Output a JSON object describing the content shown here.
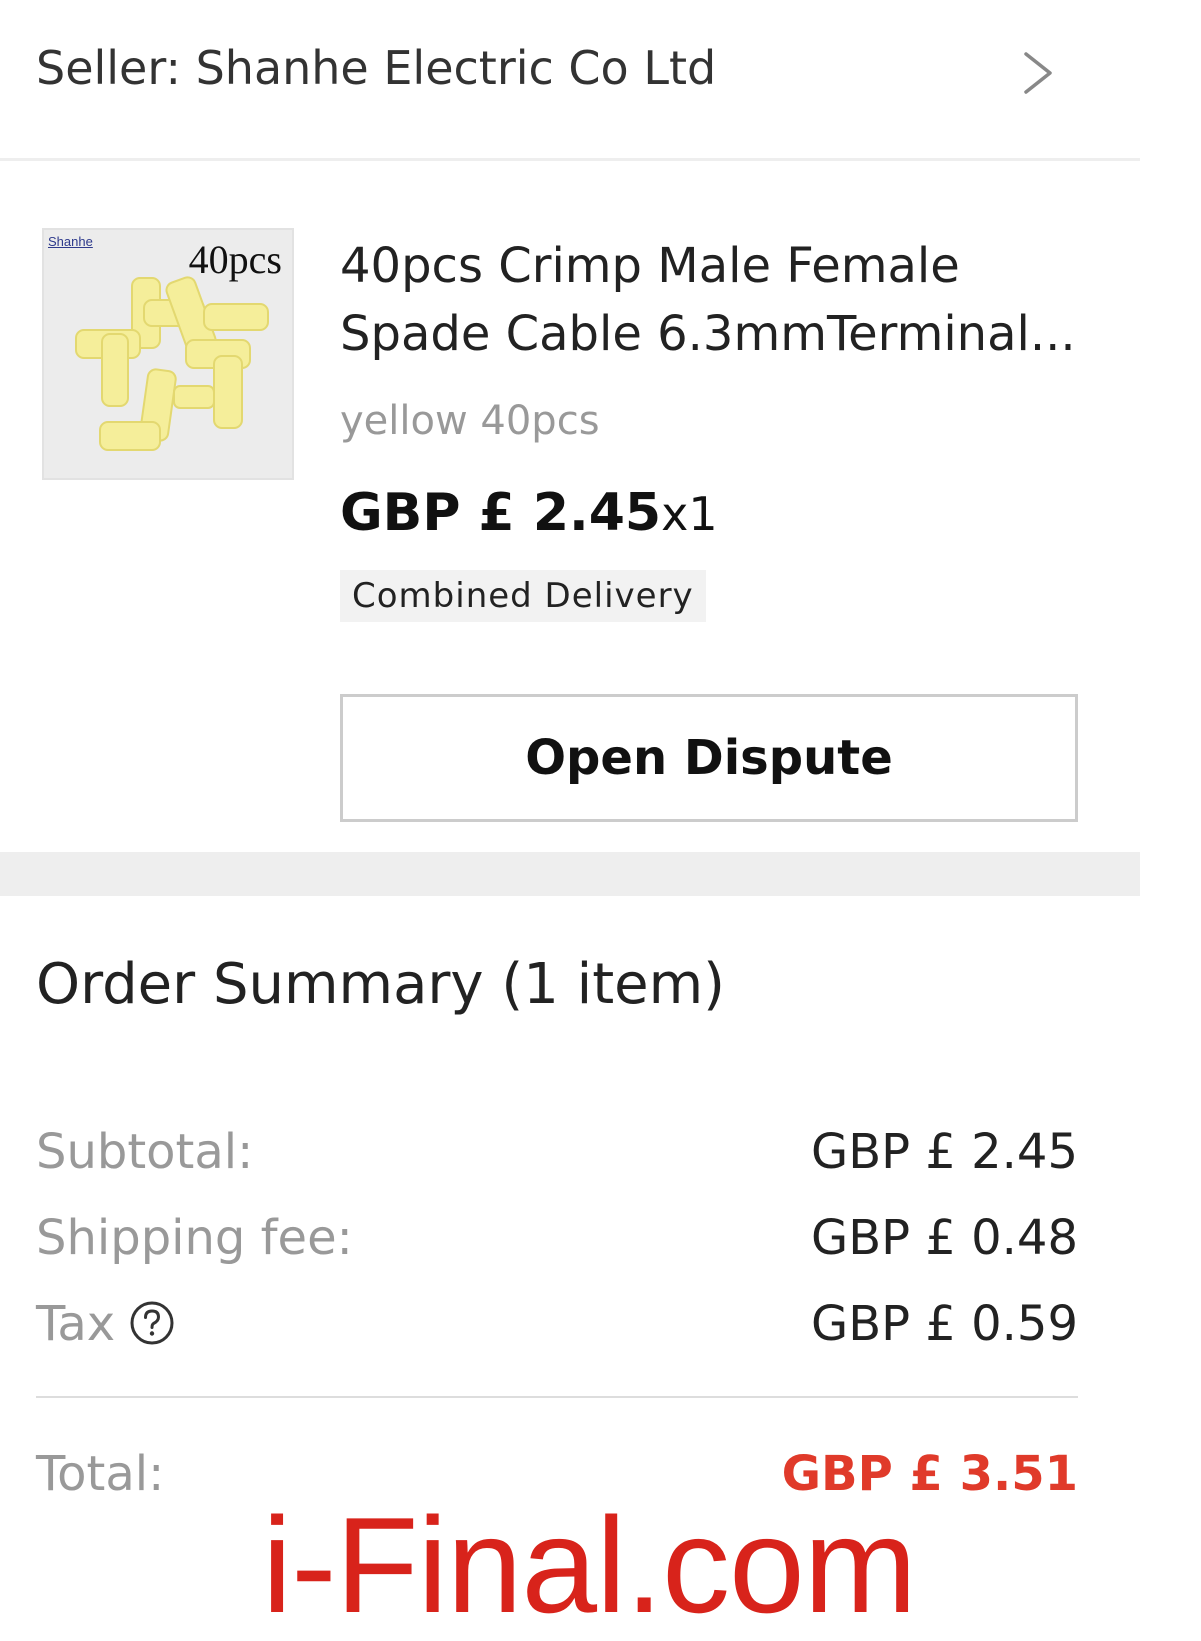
{
  "seller": {
    "label": "Seller: Shanhe Electric Co Ltd"
  },
  "product": {
    "thumbnail": {
      "brand": "Shanhe",
      "qty_label": "40pcs",
      "item_color": "#f5ee9a"
    },
    "title_line1": "40pcs Crimp Male Female",
    "title_line2": "Spade Cable 6.3mmTerminal...",
    "variant": "yellow 40pcs",
    "price": "GBP  £ 2.45",
    "quantity": "x1",
    "delivery_badge": "Combined Delivery",
    "dispute_button": "Open Dispute"
  },
  "summary": {
    "title": "Order Summary (1 item)",
    "rows": [
      {
        "label": "Subtotal:",
        "value": "GBP  £ 2.45"
      },
      {
        "label": "Shipping fee:",
        "value": "GBP  £ 0.48"
      },
      {
        "label": "Tax",
        "value": "GBP  £ 0.59"
      }
    ],
    "total_label": "Total:",
    "total_value": "GBP  £ 3.51"
  },
  "watermark": "i-Final.com",
  "colors": {
    "total_accent": "#e03a2a",
    "watermark": "#d8231b"
  }
}
